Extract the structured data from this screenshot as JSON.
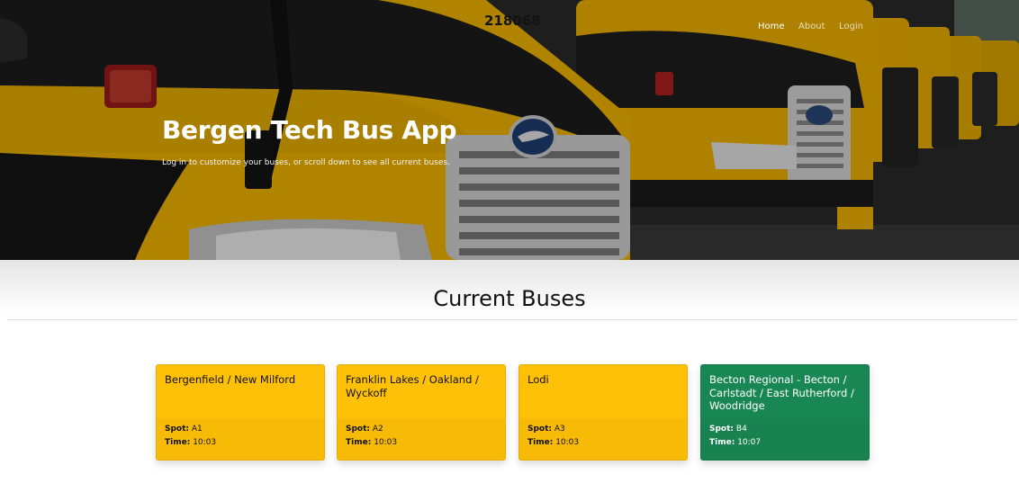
{
  "nav": {
    "items": [
      {
        "label": "Home",
        "active": true
      },
      {
        "label": "About",
        "active": false
      },
      {
        "label": "Login",
        "active": false
      }
    ]
  },
  "hero": {
    "title": "Bergen Tech Bus App",
    "subtitle": "Log in to customize your buses, or scroll down to see all current buses.",
    "bus_number": "218068"
  },
  "main": {
    "section_title": "Current Buses",
    "spot_label": "Spot:",
    "time_label": "Time:",
    "buses": [
      {
        "route": "Bergenfield / New Milford",
        "spot": "A1",
        "time": "10:03",
        "status_color": "#ffc107"
      },
      {
        "route": "Franklin Lakes / Oakland / Wyckoff",
        "spot": "A2",
        "time": "10:03",
        "status_color": "#ffc107"
      },
      {
        "route": "Lodi",
        "spot": "A3",
        "time": "10:03",
        "status_color": "#ffc107"
      },
      {
        "route": "Becton Regional - Becton / Carlstadt / East Rutherford / Woodridge",
        "spot": "B4",
        "time": "10:07",
        "status_color": "#198754"
      }
    ]
  },
  "colors": {
    "bus_yellow": "#f5b800",
    "card_yellow": "#ffc107",
    "card_green": "#198754"
  }
}
